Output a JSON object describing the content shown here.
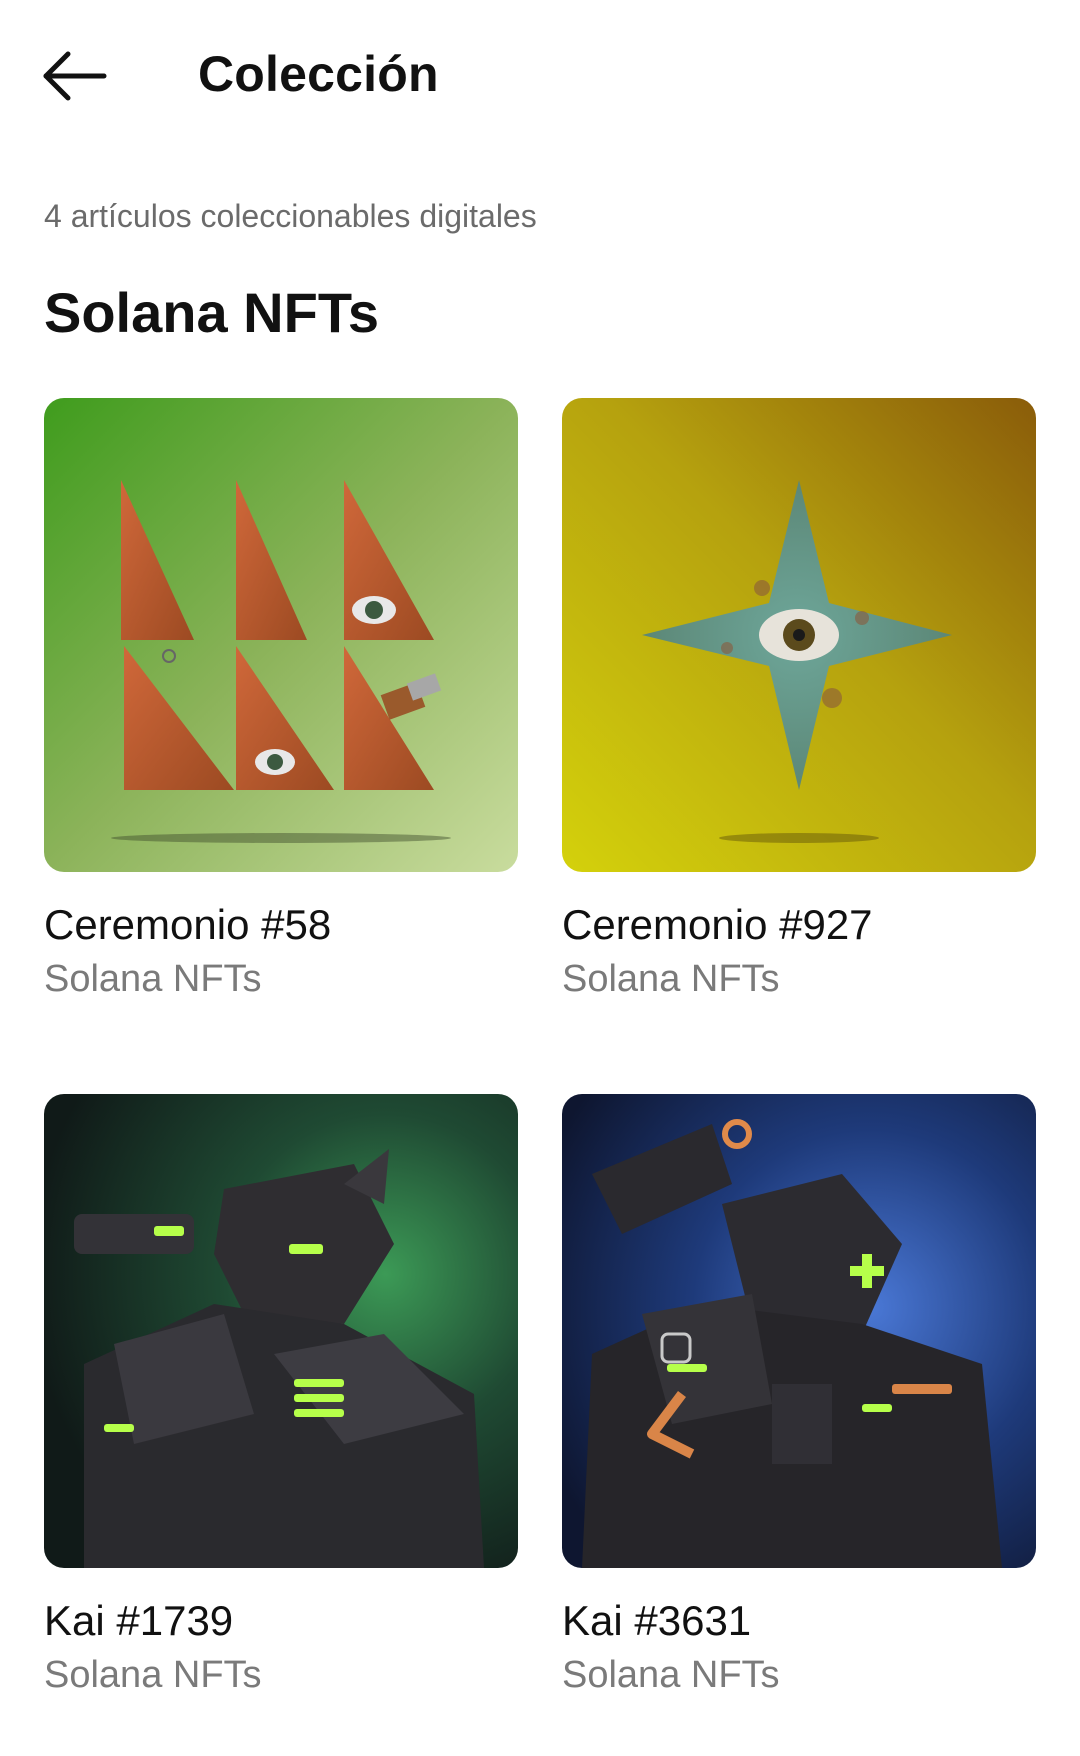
{
  "header": {
    "title": "Colección",
    "back_icon": "arrow-left-icon"
  },
  "summary": {
    "count_text": "4 artículos coleccionables digitales"
  },
  "collection": {
    "name": "Solana NFTs"
  },
  "nfts": [
    {
      "name": "Ceremonio #58",
      "collection": "Solana NFTs",
      "art": "green-triangles-with-eyes"
    },
    {
      "name": "Ceremonio #927",
      "collection": "Solana NFTs",
      "art": "rusty-star-with-eye"
    },
    {
      "name": "Kai #1739",
      "collection": "Solana NFTs",
      "art": "black-robot-green-glow"
    },
    {
      "name": "Kai #3631",
      "collection": "Solana NFTs",
      "art": "black-robot-blue-glow"
    }
  ],
  "colors": {
    "text_primary": "#111111",
    "text_secondary": "#7a7a7a",
    "background": "#ffffff"
  }
}
